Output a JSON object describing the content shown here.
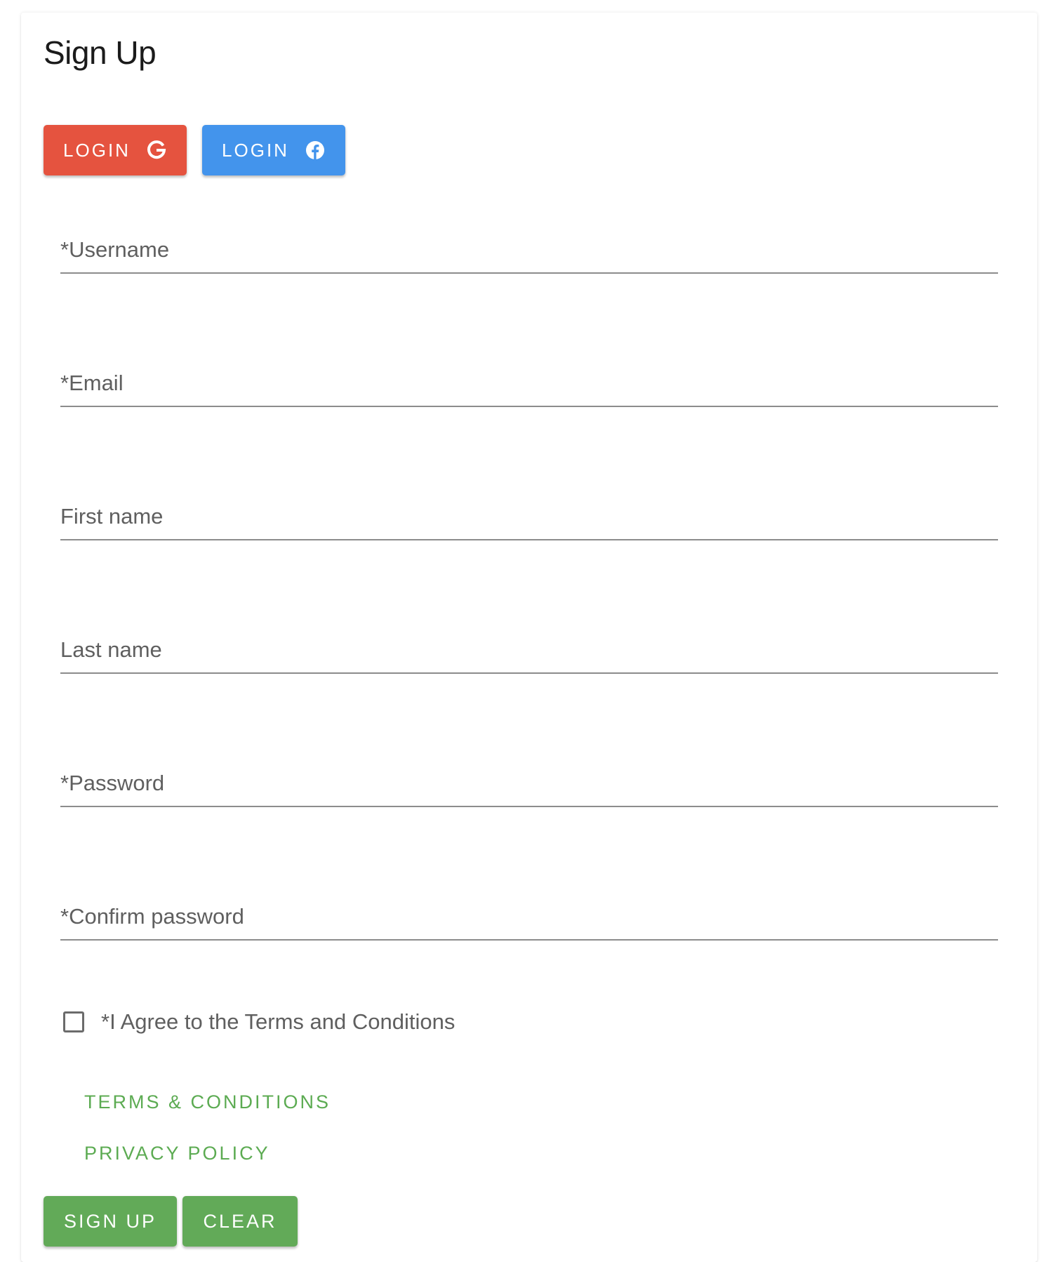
{
  "page": {
    "title": "Sign Up"
  },
  "social_login": {
    "google": {
      "label": "LOGIN",
      "icon": "google-g-icon",
      "color": "#e5533f"
    },
    "facebook": {
      "label": "LOGIN",
      "icon": "facebook-icon",
      "color": "#4394ec"
    }
  },
  "form": {
    "fields": [
      {
        "label": "*Username",
        "value": ""
      },
      {
        "label": "*Email",
        "value": ""
      },
      {
        "label": "First name",
        "value": ""
      },
      {
        "label": "Last name",
        "value": ""
      },
      {
        "label": "*Password",
        "value": ""
      },
      {
        "label": "*Confirm password",
        "value": ""
      }
    ],
    "agree_checkbox": {
      "label": "*I Agree to the Terms and Conditions",
      "checked": false
    }
  },
  "links": {
    "terms": "TERMS & CONDITIONS",
    "privacy": "PRIVACY POLICY"
  },
  "actions": {
    "signup": "SIGN UP",
    "clear": "CLEAR"
  },
  "colors": {
    "accent_green": "#62aa58",
    "link_green": "#5cab52",
    "google_red": "#e5533f",
    "facebook_blue": "#4394ec"
  }
}
